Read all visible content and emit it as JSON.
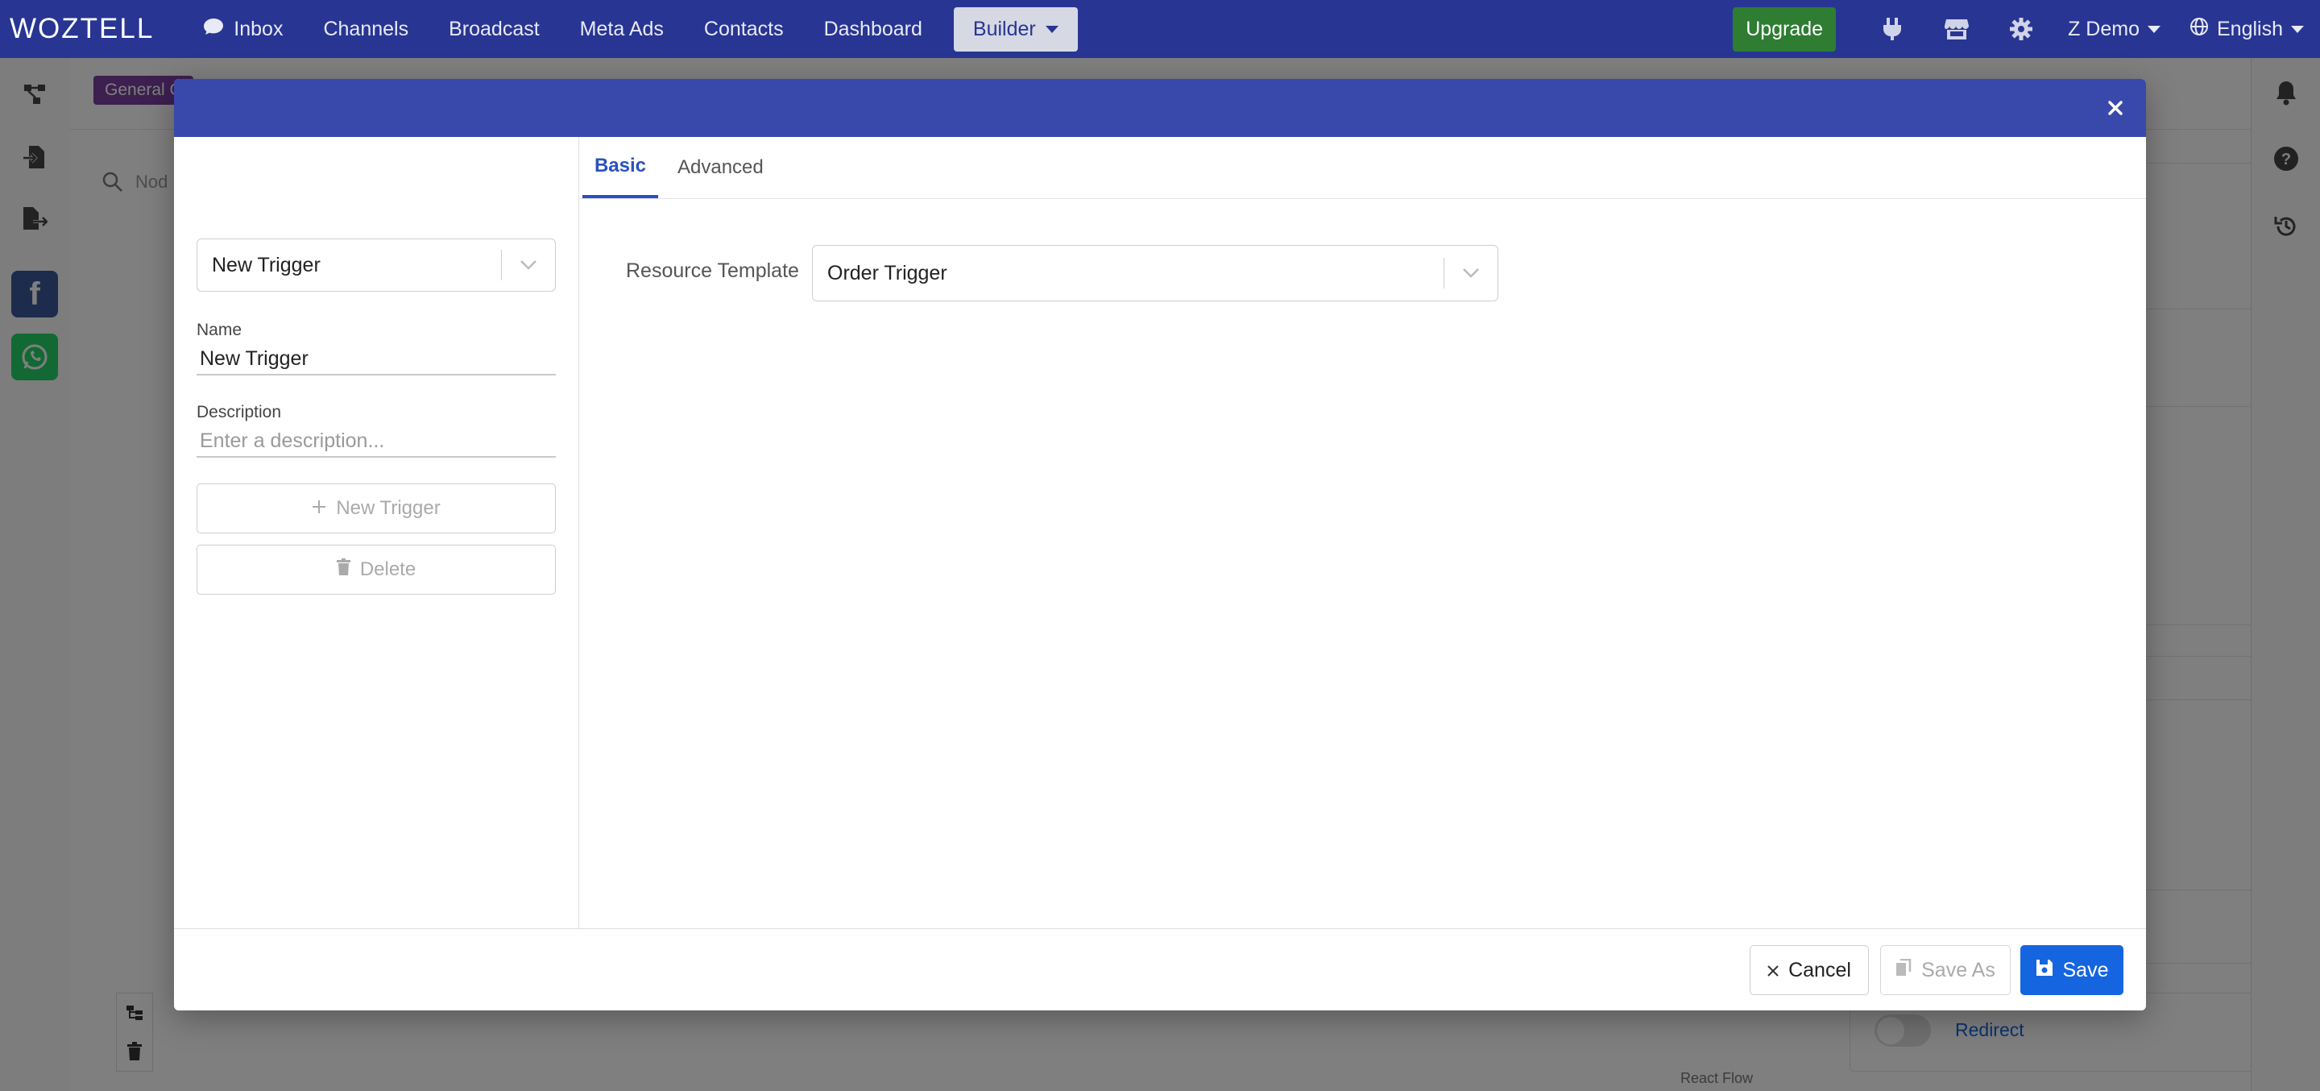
{
  "nav": {
    "brand": "WOZTELL",
    "items": [
      "Inbox",
      "Channels",
      "Broadcast",
      "Meta Ads",
      "Contacts",
      "Dashboard"
    ],
    "builder": "Builder",
    "upgrade": "Upgrade",
    "user": "Z Demo",
    "language": "English"
  },
  "background": {
    "badge": "General C",
    "search_placeholder": "Nod",
    "redirect_label": "Redirect",
    "react_flow": "React Flow"
  },
  "modal": {
    "left": {
      "selector_value": "New Trigger",
      "name_label": "Name",
      "name_value": "New Trigger",
      "description_label": "Description",
      "description_placeholder": "Enter a description...",
      "new_button": "New Trigger",
      "delete_button": "Delete"
    },
    "tabs": [
      "Basic",
      "Advanced"
    ],
    "active_tab": "Basic",
    "basic": {
      "resource_template_label": "Resource Template",
      "resource_template_value": "Order Trigger"
    },
    "footer": {
      "cancel": "Cancel",
      "save_as": "Save As",
      "save": "Save"
    }
  },
  "colors": {
    "nav_bg": "#283593",
    "modal_header": "#3949ab",
    "primary": "#1565e0",
    "upgrade": "#2e7d32",
    "tab_active": "#2a52be"
  }
}
